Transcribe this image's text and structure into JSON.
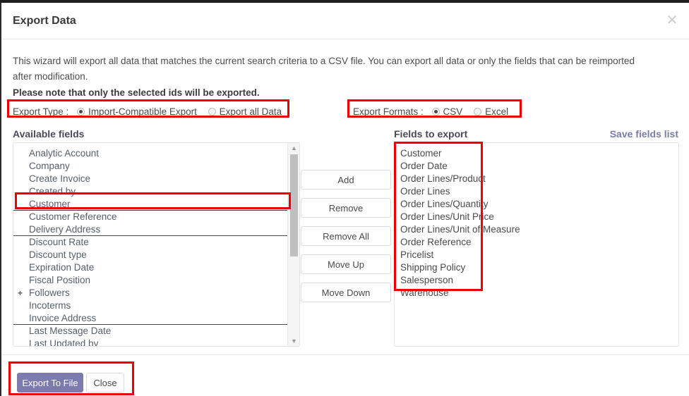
{
  "dialog": {
    "title": "Export Data",
    "close_icon": "close-icon",
    "intro": "This wizard will export all data that matches the current search criteria to a CSV file. You can export all data or only the fields that can be reimported after modification.",
    "note": "Please note that only the selected ids will be exported."
  },
  "export_type": {
    "label": "Export Type :",
    "options": [
      {
        "label": "Import-Compatible Export",
        "selected": true
      },
      {
        "label": "Export all Data",
        "selected": false
      }
    ]
  },
  "export_formats": {
    "label": "Export Formats :",
    "options": [
      {
        "label": "CSV",
        "selected": true
      },
      {
        "label": "Excel",
        "selected": false
      }
    ]
  },
  "available_fields": {
    "heading": "Available fields",
    "items": [
      {
        "label": "Analytic Account",
        "expandable": false,
        "separator": false
      },
      {
        "label": "Company",
        "expandable": false,
        "separator": false
      },
      {
        "label": "Create Invoice",
        "expandable": false,
        "separator": false
      },
      {
        "label": "Created by",
        "expandable": false,
        "separator": false
      },
      {
        "label": "Customer",
        "expandable": false,
        "separator": true
      },
      {
        "label": "Customer Reference",
        "expandable": false,
        "separator": false
      },
      {
        "label": "Delivery Address",
        "expandable": false,
        "separator": true
      },
      {
        "label": "Discount Rate",
        "expandable": false,
        "separator": false
      },
      {
        "label": "Discount type",
        "expandable": false,
        "separator": false
      },
      {
        "label": "Expiration Date",
        "expandable": false,
        "separator": false
      },
      {
        "label": "Fiscal Position",
        "expandable": false,
        "separator": false
      },
      {
        "label": "Followers",
        "expandable": true,
        "separator": false
      },
      {
        "label": "Incoterms",
        "expandable": false,
        "separator": false
      },
      {
        "label": "Invoice Address",
        "expandable": false,
        "separator": true
      },
      {
        "label": "Last Message Date",
        "expandable": false,
        "separator": false
      },
      {
        "label": "Last Updated by",
        "expandable": false,
        "separator": false
      }
    ],
    "expander_glyph": "+",
    "scroll_up_glyph": "▲",
    "scroll_down_glyph": "▼"
  },
  "fields_to_export": {
    "heading": "Fields to export",
    "save_link": "Save fields list",
    "items": [
      "Customer",
      "Order Date",
      "Order Lines/Product",
      "Order Lines",
      "Order Lines/Quantity",
      "Order Lines/Unit Price",
      "Order Lines/Unit of Measure",
      "Order Reference",
      "Pricelist",
      "Shipping Policy",
      "Salesperson",
      "Warehouse"
    ]
  },
  "transfer_buttons": [
    {
      "label": "Add",
      "name": "add-button"
    },
    {
      "label": "Remove",
      "name": "remove-button"
    },
    {
      "label": "Remove All",
      "name": "remove-all-button"
    },
    {
      "label": "Move Up",
      "name": "move-up-button"
    },
    {
      "label": "Move Down",
      "name": "move-down-button"
    }
  ],
  "footer": {
    "export_label": "Export To File",
    "close_label": "Close"
  },
  "colors": {
    "brand": "#7c7bad",
    "annotation": "#ef0000",
    "text": "#4c4c4c"
  }
}
